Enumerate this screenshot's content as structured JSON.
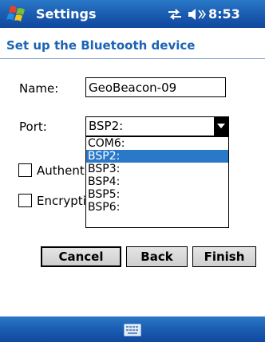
{
  "titlebar": {
    "app_title": "Settings",
    "time": "8:53"
  },
  "page": {
    "title": "Set up the Bluetooth device"
  },
  "form": {
    "name_label": "Name:",
    "name_value": "GeoBeacon-09",
    "port_label": "Port:",
    "port_value": "BSP2:",
    "port_options": [
      "COM6:",
      "BSP2:",
      "BSP3:",
      "BSP4:",
      "BSP5:",
      "BSP6:"
    ],
    "selected_option_index": 1,
    "auth_label": "Authent",
    "enc_label": "Encrypti"
  },
  "buttons": {
    "cancel": "Cancel",
    "back": "Back",
    "finish": "Finish"
  },
  "colors": {
    "titlebar_blue": "#1c5fb2",
    "accent": "#1a63b6",
    "selection": "#2a79c9"
  },
  "icons": [
    "windows-flag-icon",
    "connectivity-icon",
    "volume-icon",
    "keyboard-icon"
  ]
}
